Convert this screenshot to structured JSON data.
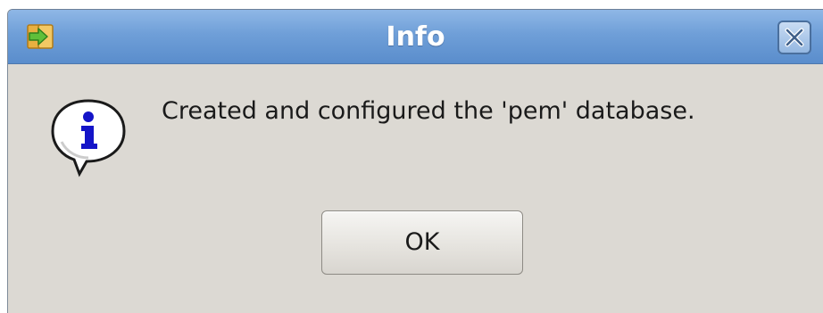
{
  "dialog": {
    "title": "Info",
    "message": "Created and configured the 'pem' database.",
    "ok_label": "OK",
    "icons": {
      "app": "app-arrow-icon",
      "close": "close-icon",
      "info": "info-icon"
    },
    "colors": {
      "titlebar": "#6f9fd8",
      "body": "#dcd9d3",
      "info_icon_glyph": "#1414c8"
    }
  }
}
